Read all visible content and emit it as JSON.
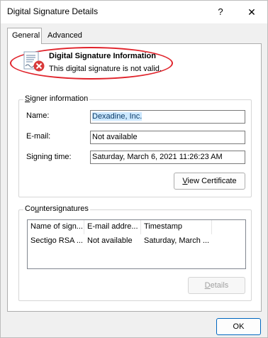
{
  "window": {
    "title": "Digital Signature Details",
    "help_glyph": "?",
    "close_glyph": "✕"
  },
  "tabs": [
    {
      "label": "General",
      "selected": true
    },
    {
      "label": "Advanced",
      "selected": false
    }
  ],
  "signature_info": {
    "heading": "Digital Signature Information",
    "status": "This digital signature is not valid.",
    "status_color": "#e0222a"
  },
  "signer": {
    "group_label_accel": "S",
    "group_label_rest": "igner information",
    "name_label": "Name:",
    "name_value": "Dexadine, Inc.",
    "email_label": "E-mail:",
    "email_value": "Not available",
    "time_label": "Signing time:",
    "time_value": "Saturday, March 6, 2021 11:26:23 AM",
    "view_cert_accel": "V",
    "view_cert_rest": "iew Certificate"
  },
  "countersignatures": {
    "group_label_prefix": "Co",
    "group_label_accel": "u",
    "group_label_rest": "ntersignatures",
    "columns": [
      "Name of sign...",
      "E-mail addre...",
      "Timestamp"
    ],
    "rows": [
      [
        "Sectigo RSA ...",
        "Not available",
        "Saturday, March ..."
      ]
    ],
    "details_accel": "D",
    "details_rest": "etails"
  },
  "footer": {
    "ok_label": "OK"
  }
}
